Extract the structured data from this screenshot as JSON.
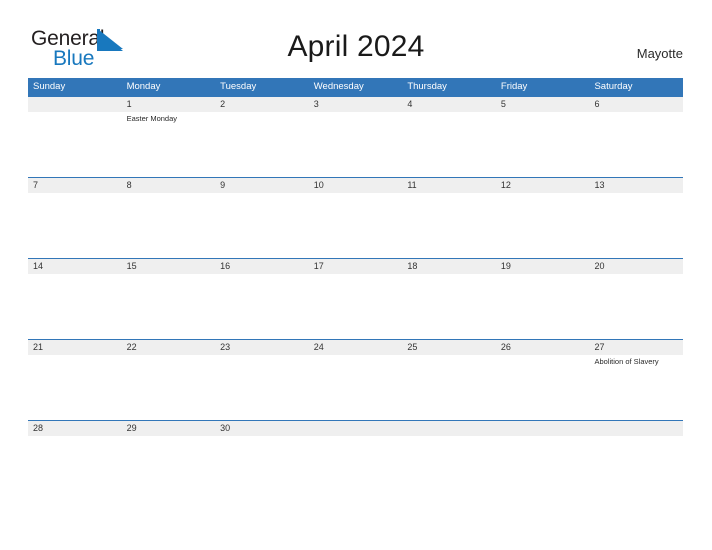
{
  "logo": {
    "primary_text": "General",
    "secondary_text": "Blue",
    "primary_color": "#231f20",
    "secondary_color": "#1878be",
    "flag_color": "#1878be"
  },
  "header": {
    "title": "April 2024",
    "region": "Mayotte",
    "header_bg_color": "#3276b8",
    "date_band_color": "#efefef"
  },
  "calendar": {
    "weekdays": [
      "Sunday",
      "Monday",
      "Tuesday",
      "Wednesday",
      "Thursday",
      "Friday",
      "Saturday"
    ],
    "weeks": [
      {
        "days": [
          {
            "date": "",
            "event": ""
          },
          {
            "date": "1",
            "event": "Easter Monday"
          },
          {
            "date": "2",
            "event": ""
          },
          {
            "date": "3",
            "event": ""
          },
          {
            "date": "4",
            "event": ""
          },
          {
            "date": "5",
            "event": ""
          },
          {
            "date": "6",
            "event": ""
          }
        ]
      },
      {
        "days": [
          {
            "date": "7",
            "event": ""
          },
          {
            "date": "8",
            "event": ""
          },
          {
            "date": "9",
            "event": ""
          },
          {
            "date": "10",
            "event": ""
          },
          {
            "date": "11",
            "event": ""
          },
          {
            "date": "12",
            "event": ""
          },
          {
            "date": "13",
            "event": ""
          }
        ]
      },
      {
        "days": [
          {
            "date": "14",
            "event": ""
          },
          {
            "date": "15",
            "event": ""
          },
          {
            "date": "16",
            "event": ""
          },
          {
            "date": "17",
            "event": ""
          },
          {
            "date": "18",
            "event": ""
          },
          {
            "date": "19",
            "event": ""
          },
          {
            "date": "20",
            "event": ""
          }
        ]
      },
      {
        "days": [
          {
            "date": "21",
            "event": ""
          },
          {
            "date": "22",
            "event": ""
          },
          {
            "date": "23",
            "event": ""
          },
          {
            "date": "24",
            "event": ""
          },
          {
            "date": "25",
            "event": ""
          },
          {
            "date": "26",
            "event": ""
          },
          {
            "date": "27",
            "event": "Abolition of Slavery"
          }
        ]
      },
      {
        "days": [
          {
            "date": "28",
            "event": ""
          },
          {
            "date": "29",
            "event": ""
          },
          {
            "date": "30",
            "event": ""
          },
          {
            "date": "",
            "event": ""
          },
          {
            "date": "",
            "event": ""
          },
          {
            "date": "",
            "event": ""
          },
          {
            "date": "",
            "event": ""
          }
        ]
      }
    ]
  }
}
